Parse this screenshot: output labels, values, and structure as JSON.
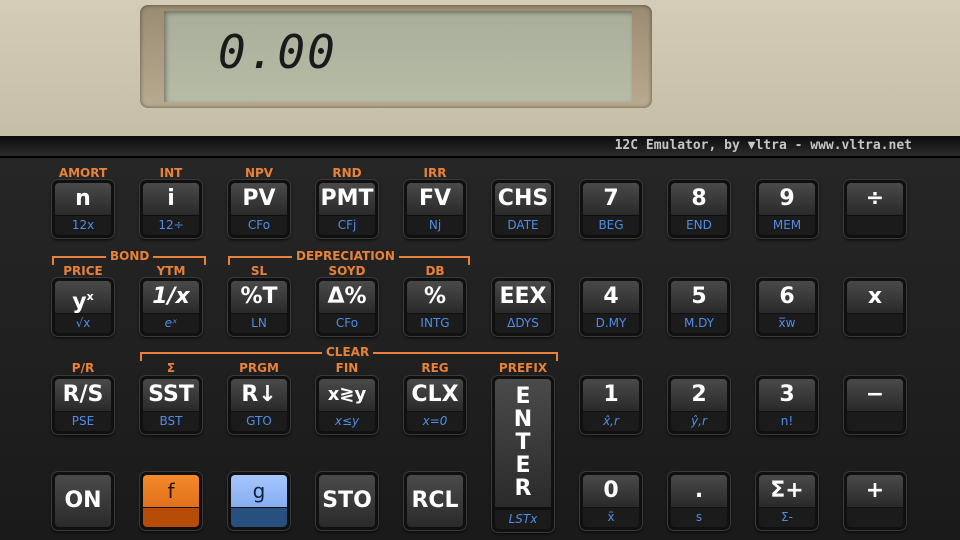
{
  "display": {
    "value": "0.00"
  },
  "branding": {
    "text": "12C Emulator, by ▼ltra - www.vltra.net"
  },
  "groups": {
    "bond": "BOND",
    "depreciation": "DEPRECIATION",
    "clear": "CLEAR",
    "sigma": "Σ"
  },
  "keys": {
    "n": {
      "f": "AMORT",
      "label": "n",
      "g": "12x"
    },
    "i": {
      "f": "INT",
      "label": "i",
      "g": "12÷"
    },
    "pv": {
      "f": "NPV",
      "label": "PV",
      "g": "CFo"
    },
    "pmt": {
      "f": "RND",
      "label": "PMT",
      "g": "CFj"
    },
    "fv": {
      "f": "IRR",
      "label": "FV",
      "g": "Nj"
    },
    "chs": {
      "label": "CHS",
      "g": "DATE"
    },
    "k7": {
      "label": "7",
      "g": "BEG"
    },
    "k8": {
      "label": "8",
      "g": "END"
    },
    "k9": {
      "label": "9",
      "g": "MEM"
    },
    "div": {
      "label": "÷"
    },
    "yx": {
      "f": "PRICE",
      "label": "y",
      "label_sup": "x",
      "g": "√x"
    },
    "inv": {
      "f": "YTM",
      "label": "1/x",
      "g": "eˣ"
    },
    "pctt": {
      "f": "SL",
      "label": "%T",
      "g": "LN"
    },
    "dpct": {
      "f": "SOYD",
      "label": "Δ%",
      "g": "CFo"
    },
    "pct": {
      "f": "DB",
      "label": "%",
      "g": "INTG"
    },
    "eex": {
      "label": "EEX",
      "g": "ΔDYS"
    },
    "k4": {
      "label": "4",
      "g": "D.MY"
    },
    "k5": {
      "label": "5",
      "g": "M.DY"
    },
    "k6": {
      "label": "6",
      "g": "x̅w"
    },
    "mul": {
      "label": "x"
    },
    "rs": {
      "f": "P/R",
      "label": "R/S",
      "g": "PSE"
    },
    "sst": {
      "f": "Σ",
      "label": "SST",
      "g": "BST"
    },
    "rdn": {
      "f": "PRGM",
      "label": "R↓",
      "g": "GTO"
    },
    "xy": {
      "f": "FIN",
      "label": "x≷y",
      "g": "x≤y"
    },
    "clx": {
      "f": "REG",
      "label": "CLX",
      "g": "x=0"
    },
    "enter": {
      "f": "PREFIX",
      "letters": [
        "E",
        "N",
        "T",
        "E",
        "R"
      ],
      "g": "LSTx"
    },
    "k1": {
      "label": "1",
      "g": "x̂,r"
    },
    "k2": {
      "label": "2",
      "g": "ŷ,r"
    },
    "k3": {
      "label": "3",
      "g": "n!"
    },
    "sub": {
      "label": "−"
    },
    "on": {
      "label": "ON"
    },
    "f": {
      "label": "f"
    },
    "g": {
      "label": "g"
    },
    "sto": {
      "label": "STO"
    },
    "rcl": {
      "label": "RCL"
    },
    "k0": {
      "label": "0",
      "g": "x̄"
    },
    "dot": {
      "label": ".",
      "g": "s"
    },
    "splus": {
      "label": "Σ+",
      "g": "Σ-"
    },
    "add": {
      "label": "+"
    }
  }
}
